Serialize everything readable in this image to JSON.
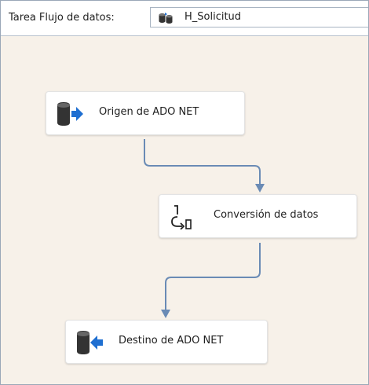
{
  "toolbar": {
    "task_label": "Tarea Flujo de datos:",
    "selected_task": "H_Solicitud",
    "selected_task_icon": "data-flow-task-icon"
  },
  "components": [
    {
      "label": "Origen de ADO NET",
      "icon": "ado-net-source-icon"
    },
    {
      "label": "Conversión de datos",
      "icon": "data-conversion-icon"
    },
    {
      "label": "Destino de ADO NET",
      "icon": "ado-net-destination-icon"
    }
  ],
  "colors": {
    "canvas_background": "#f7f1e9",
    "connector": "#6a8bb5",
    "database_icon": "#333333",
    "arrow_icon": "#1f6fd1"
  }
}
